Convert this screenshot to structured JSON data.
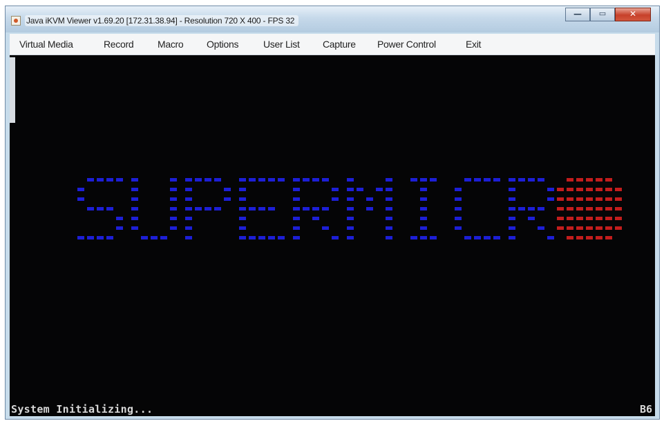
{
  "window": {
    "title": "Java iKVM Viewer v1.69.20 [172.31.38.94]  - Resolution 720 X 400 - FPS 32",
    "buttons": {
      "minimize": "—",
      "maximize": "▭",
      "close": "✕"
    }
  },
  "menu": {
    "items": [
      "Virtual Media",
      "Record",
      "Macro",
      "Options",
      "User List",
      "Capture",
      "Power Control",
      "Exit"
    ]
  },
  "console": {
    "logo_text": "SUPERMICR",
    "logo_mark": "O",
    "colors": {
      "logo_text": "#1d1fd6",
      "logo_mark": "#c31d1d"
    },
    "status_text": "System Initializing...",
    "post_code": "B6"
  }
}
